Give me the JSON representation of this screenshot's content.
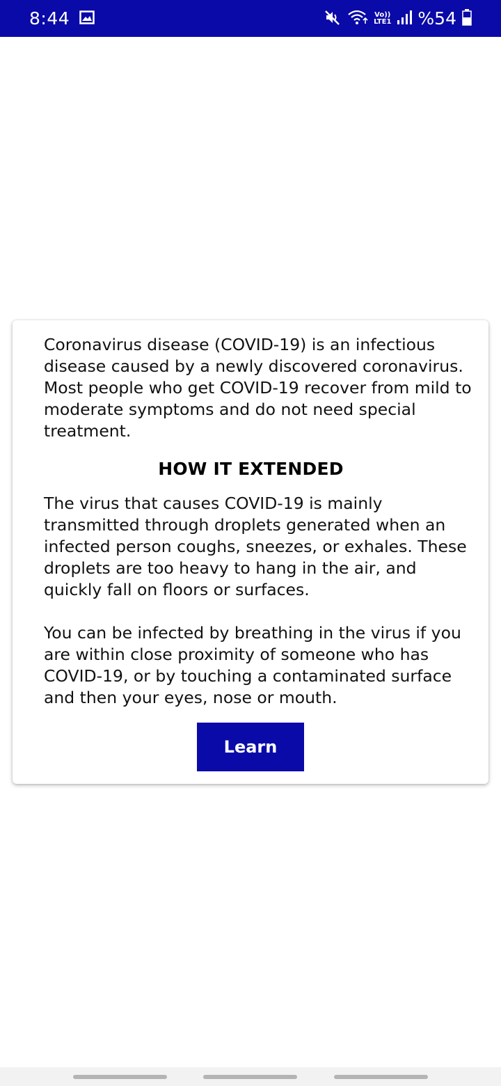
{
  "status_bar": {
    "time": "8:44",
    "battery_percent": "%54",
    "volte_top": "Vo))",
    "volte_bottom": "LTE1",
    "icons": [
      "gallery-icon",
      "mute-icon",
      "wifi-icon",
      "signal-icon",
      "battery-icon"
    ],
    "background_color": "#0a0aa8"
  },
  "card": {
    "intro": "Coronavirus disease (COVID-19) is an infectious disease caused by a newly discovered coronavirus. Most people who get COVID-19 recover from mild to moderate symptoms and do not need special treatment.",
    "heading": "HOW IT EXTENDED",
    "paragraph_1": "The virus that causes COVID-19 is mainly transmitted through droplets generated when an infected person coughs, sneezes, or exhales. These droplets are too heavy to hang in the air, and quickly fall on floors or surfaces.",
    "paragraph_2": "You can be infected by breathing in the virus if you are within close proximity of someone who has COVID-19, or by touching a contaminated surface and then your eyes, nose or mouth.",
    "button_label": "Learn",
    "button_color": "#0a0aa8"
  }
}
